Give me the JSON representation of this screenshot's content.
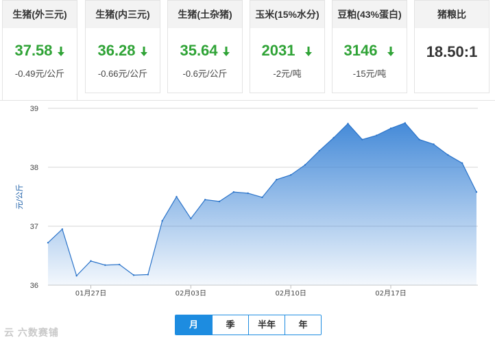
{
  "colors": {
    "down": "#2fa336",
    "accent": "#1d8ce0",
    "line": "#3b84d6"
  },
  "cards": [
    {
      "title": "生猪(外三元)",
      "price": "37.58",
      "change": "-0.49元/公斤",
      "trend_icon": "arrow-down-icon"
    },
    {
      "title": "生猪(内三元)",
      "price": "36.28",
      "change": "-0.66元/公斤",
      "trend_icon": "arrow-down-icon"
    },
    {
      "title": "生猪(土杂猪)",
      "price": "35.64",
      "change": "-0.6元/公斤",
      "trend_icon": "arrow-down-icon"
    },
    {
      "title": "玉米(15%水分)",
      "price": "2031",
      "change": "-2元/吨",
      "trend_icon": "arrow-down-icon"
    },
    {
      "title": "豆粕(43%蛋白)",
      "price": "3146",
      "change": "-15元/吨",
      "trend_icon": "arrow-down-icon"
    }
  ],
  "ratio_card": {
    "title": "猪粮比",
    "value": "18.50:1"
  },
  "chart_data": {
    "type": "area",
    "ylabel": "元/公斤",
    "ylim": [
      36,
      39
    ],
    "yticks": [
      36,
      37,
      38,
      39
    ],
    "grid": true,
    "legend": "none",
    "xticks": [
      {
        "label": "01月27日",
        "index": 3
      },
      {
        "label": "02月03日",
        "index": 10
      },
      {
        "label": "02月10日",
        "index": 17
      },
      {
        "label": "02月17日",
        "index": 24
      }
    ],
    "series": [
      {
        "values": [
          36.72,
          36.95,
          36.16,
          36.41,
          36.34,
          36.35,
          36.17,
          36.18,
          37.09,
          37.5,
          37.13,
          37.45,
          37.42,
          37.58,
          37.56,
          37.49,
          37.79,
          37.87,
          38.04,
          38.28,
          38.5,
          38.74,
          38.47,
          38.54,
          38.66,
          38.75,
          38.47,
          38.39,
          38.21,
          38.07,
          37.58
        ]
      }
    ]
  },
  "range_tabs": [
    {
      "label": "月",
      "active": true
    },
    {
      "label": "季",
      "active": false
    },
    {
      "label": "半年",
      "active": false
    },
    {
      "label": "年",
      "active": false
    }
  ],
  "watermark": "云 六数赛铺"
}
